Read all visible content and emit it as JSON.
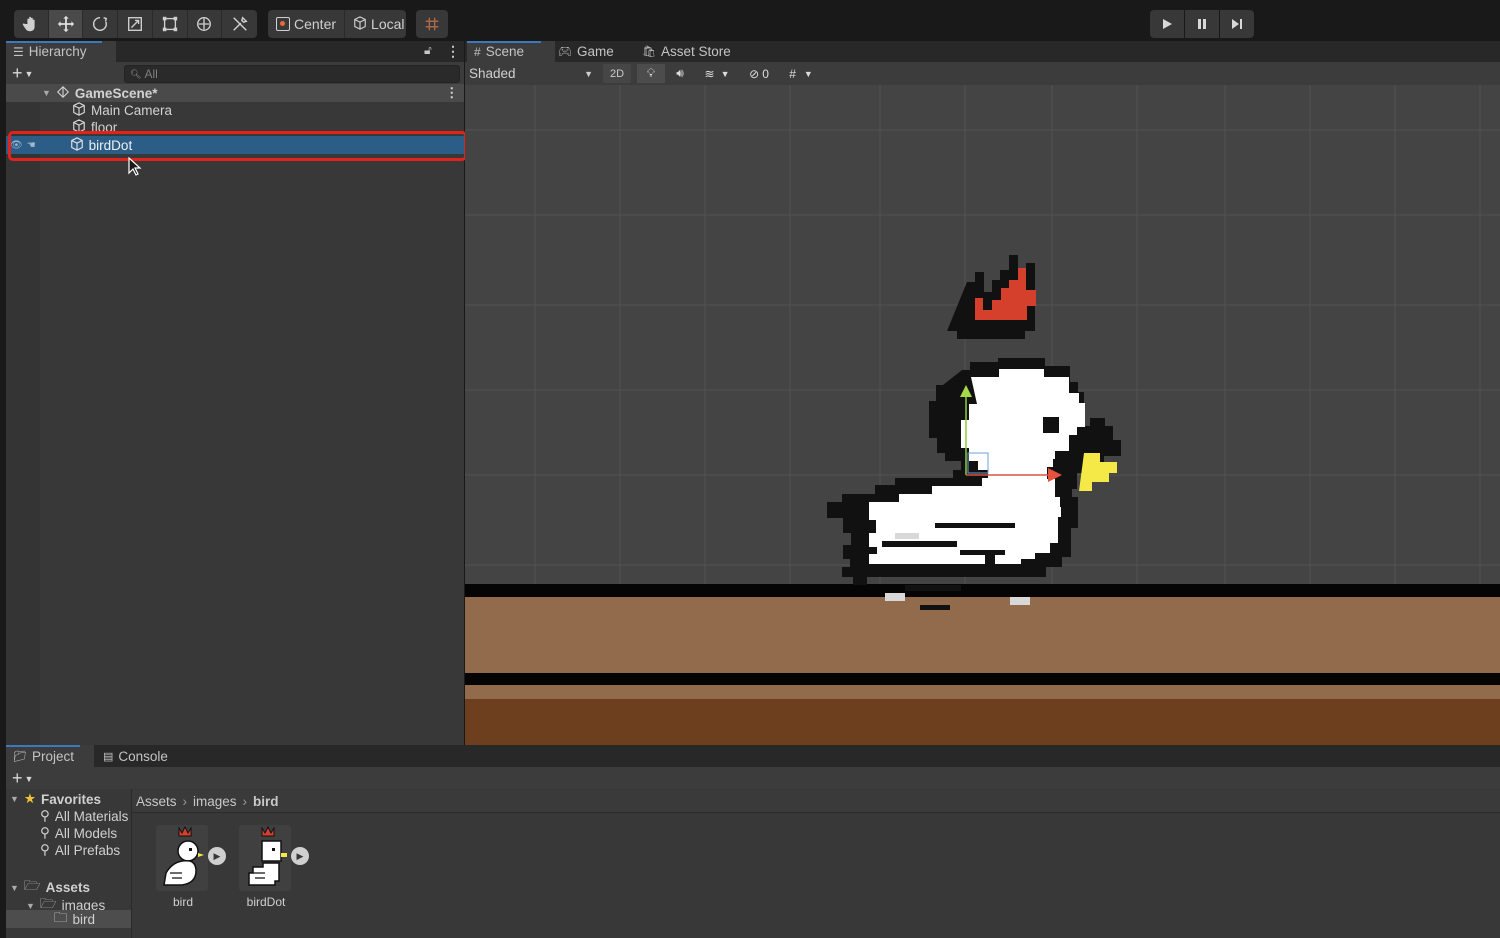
{
  "toolbar": {
    "tools": [
      "hand-tool",
      "move-tool",
      "rotate-tool",
      "scale-tool",
      "rect-tool",
      "transform-tool",
      "custom-tool"
    ],
    "pivot_label": "Center",
    "space_label": "Local"
  },
  "hierarchy": {
    "tab_label": "Hierarchy",
    "search_placeholder": "All",
    "scene_name": "GameScene*",
    "items": [
      {
        "label": "Main Camera"
      },
      {
        "label": "floor"
      },
      {
        "label": "birdDot",
        "selected": true
      }
    ]
  },
  "scene_view": {
    "tabs": [
      {
        "label": "Scene",
        "selected": true
      },
      {
        "label": "Game"
      },
      {
        "label": "Asset Store"
      }
    ],
    "shading_mode": "Shaded",
    "mode_2d_label": "2D",
    "hidden_count": "0"
  },
  "project": {
    "tabs": [
      {
        "label": "Project",
        "selected": true
      },
      {
        "label": "Console"
      }
    ],
    "favorites_label": "Favorites",
    "favorites": [
      "All Materials",
      "All Models",
      "All Prefabs"
    ],
    "assets_label": "Assets",
    "folders": [
      "images",
      "bird"
    ],
    "breadcrumb": [
      "Assets",
      "images",
      "bird"
    ],
    "assets": [
      {
        "label": "bird"
      },
      {
        "label": "birdDot"
      }
    ]
  },
  "colors": {
    "selection": "#2c5d87",
    "highlight_outline": "#e0231c",
    "scene_bg": "#444444",
    "floor_top": "#916b4c",
    "floor_bottom": "#6e3f1e"
  }
}
